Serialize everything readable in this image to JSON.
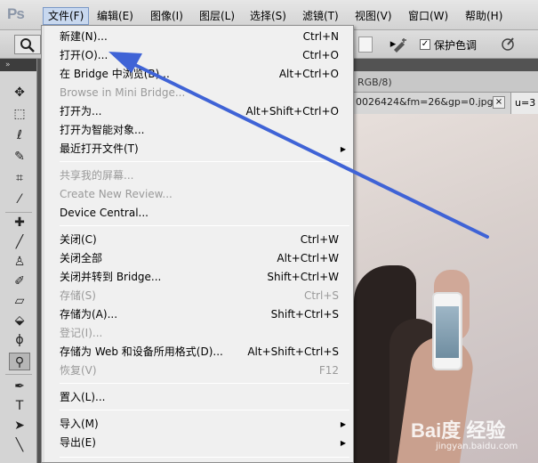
{
  "app": {
    "logo": "Ps"
  },
  "menubar": {
    "items": [
      "文件(F)",
      "编辑(E)",
      "图像(I)",
      "图层(L)",
      "选择(S)",
      "滤镜(T)",
      "视图(V)",
      "窗口(W)",
      "帮助(H)"
    ]
  },
  "options": {
    "protect_color_label": "保护色调",
    "protect_color_checked": "✓"
  },
  "documents": {
    "tab1": "RGB/8)",
    "tab2": "0026424&fm=26&gp=0.jpg",
    "tab2_close": "×",
    "tab3": "u=3"
  },
  "file_menu": {
    "items": [
      {
        "label": "新建(N)...",
        "shortcut": "Ctrl+N",
        "disabled": false
      },
      {
        "label": "打开(O)...",
        "shortcut": "Ctrl+O",
        "disabled": false
      },
      {
        "label": "在 Bridge 中浏览(B)...",
        "shortcut": "Alt+Ctrl+O",
        "disabled": false
      },
      {
        "label": "Browse in Mini Bridge...",
        "shortcut": "",
        "disabled": true
      },
      {
        "label": "打开为...",
        "shortcut": "Alt+Shift+Ctrl+O",
        "disabled": false
      },
      {
        "label": "打开为智能对象...",
        "shortcut": "",
        "disabled": false
      },
      {
        "label": "最近打开文件(T)",
        "shortcut": "",
        "disabled": false,
        "submenu": true
      },
      {
        "label": "共享我的屏幕...",
        "shortcut": "",
        "disabled": true
      },
      {
        "label": "Create New Review...",
        "shortcut": "",
        "disabled": true
      },
      {
        "label": "Device Central...",
        "shortcut": "",
        "disabled": false
      },
      {
        "label": "关闭(C)",
        "shortcut": "Ctrl+W",
        "disabled": false
      },
      {
        "label": "关闭全部",
        "shortcut": "Alt+Ctrl+W",
        "disabled": false
      },
      {
        "label": "关闭并转到 Bridge...",
        "shortcut": "Shift+Ctrl+W",
        "disabled": false
      },
      {
        "label": "存储(S)",
        "shortcut": "Ctrl+S",
        "disabled": true
      },
      {
        "label": "存储为(A)...",
        "shortcut": "Shift+Ctrl+S",
        "disabled": false
      },
      {
        "label": "登记(I)...",
        "shortcut": "",
        "disabled": true
      },
      {
        "label": "存储为 Web 和设备所用格式(D)...",
        "shortcut": "Alt+Shift+Ctrl+S",
        "disabled": false
      },
      {
        "label": "恢复(V)",
        "shortcut": "F12",
        "disabled": true
      },
      {
        "label": "置入(L)...",
        "shortcut": "",
        "disabled": false
      },
      {
        "label": "导入(M)",
        "shortcut": "",
        "disabled": false,
        "submenu": true
      },
      {
        "label": "导出(E)",
        "shortcut": "",
        "disabled": false,
        "submenu": true
      }
    ],
    "submenu_arrow": "▶"
  },
  "watermark": {
    "brand": "Bai度 经验",
    "url": "jingyan.baidu.com"
  },
  "colors": {
    "annotation_arrow": "#3f63d6",
    "menu_active": "#c8d8ef"
  }
}
